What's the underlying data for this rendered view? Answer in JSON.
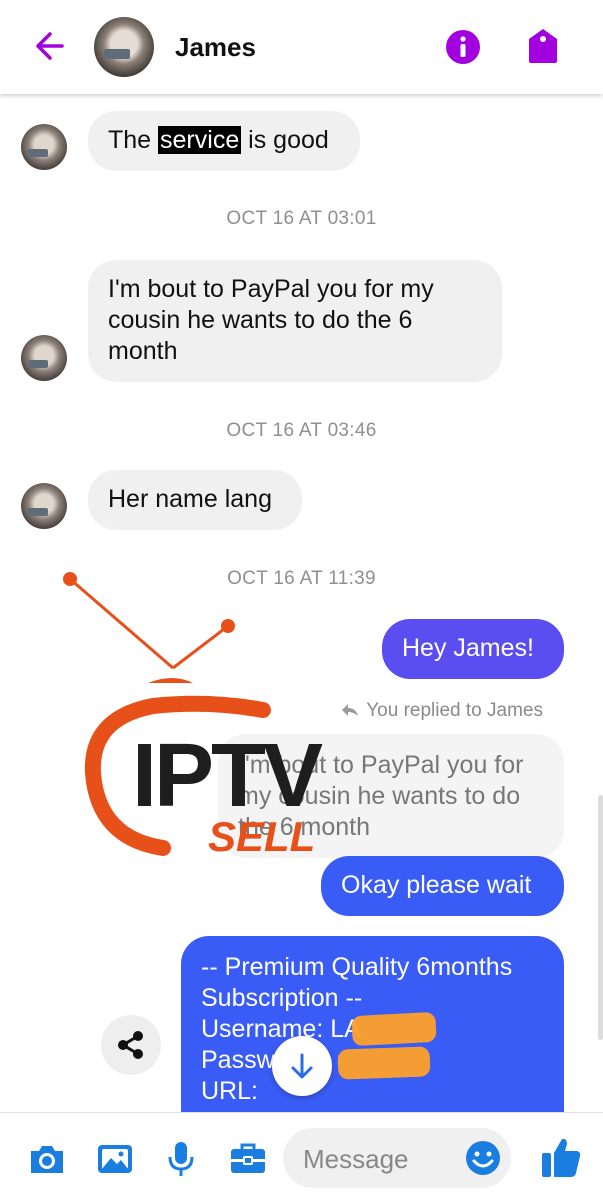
{
  "header": {
    "contact_name": "James",
    "back_icon": "arrow-left-icon",
    "info_icon": "info-icon",
    "tag_icon": "tag-icon",
    "accent": "#a300e0"
  },
  "messages": [
    {
      "type": "incoming",
      "parts": [
        "The ",
        "service",
        " is good"
      ]
    },
    {
      "type": "timestamp",
      "text": "OCT 16 AT 03:01"
    },
    {
      "type": "incoming",
      "text": "I'm bout to PayPal you for my cousin he wants to do the 6 month"
    },
    {
      "type": "timestamp",
      "text": "OCT 16 AT 03:46"
    },
    {
      "type": "incoming",
      "text": "Her name lang"
    },
    {
      "type": "timestamp",
      "text": "OCT 16 AT 11:39"
    },
    {
      "type": "outgoing",
      "text": "Hey James!"
    },
    {
      "type": "reply_note",
      "text": "You replied to James"
    },
    {
      "type": "reply_quote",
      "text": "I'm bout to PayPal you for my cousin he wants to do the 6 month"
    },
    {
      "type": "outgoing",
      "text": "Okay please wait"
    },
    {
      "type": "outgoing",
      "lines": [
        "-- Premium Quality 6months",
        "Subscription --",
        "Username: LA",
        "Passw",
        "URL:"
      ]
    }
  ],
  "watermark": {
    "main": "IPTV",
    "sub": "SELL"
  },
  "composer": {
    "placeholder": "Message",
    "icons": [
      "camera-icon",
      "image-icon",
      "microphone-icon",
      "toolbox-icon",
      "emoji-icon",
      "thumbs-up-icon"
    ]
  },
  "colors": {
    "outgoing": "#3a5cf6",
    "incoming": "#f1f0f0",
    "toolbar_icon": "#1a7ee0",
    "logo": "#e8501a"
  }
}
